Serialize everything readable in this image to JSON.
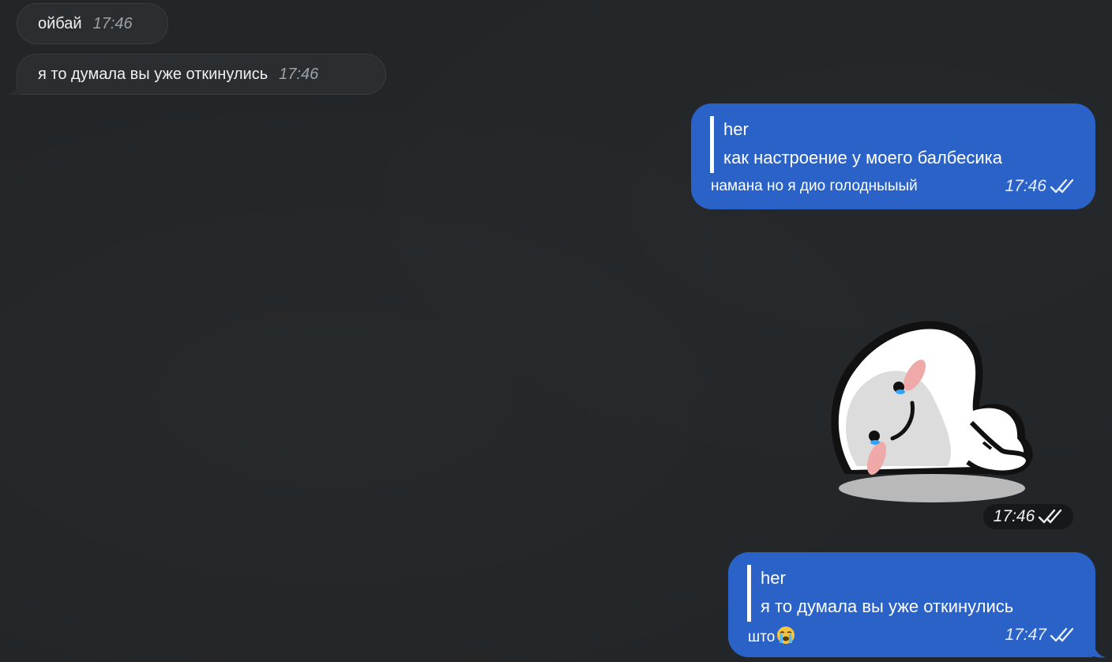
{
  "messages": {
    "m1": {
      "text": "ойбай",
      "time": "17:46"
    },
    "m2": {
      "text": "я то думала вы уже откинулись",
      "time": "17:46"
    },
    "m3": {
      "reply_author": "her",
      "reply_quote": "как настроение у моего балбесика",
      "text": "намана но я дио голодныыый",
      "time": "17:46",
      "status_icon": "double-check-icon"
    },
    "m4": {
      "sticker": "crying-ghost-sticker",
      "time": "17:46",
      "status_icon": "double-check-icon"
    },
    "m5": {
      "reply_author": "her",
      "reply_quote": "я то думала вы уже откинулись",
      "text": "што",
      "emoji": "loudly-crying-face-emoji",
      "time": "17:47",
      "status_icon": "double-check-icon"
    }
  },
  "colors": {
    "background": "#232628",
    "incoming_bubble": "#2b2e30",
    "outgoing_bubble": "#2a62c7",
    "timestamp_incoming": "#9aa3ab"
  }
}
